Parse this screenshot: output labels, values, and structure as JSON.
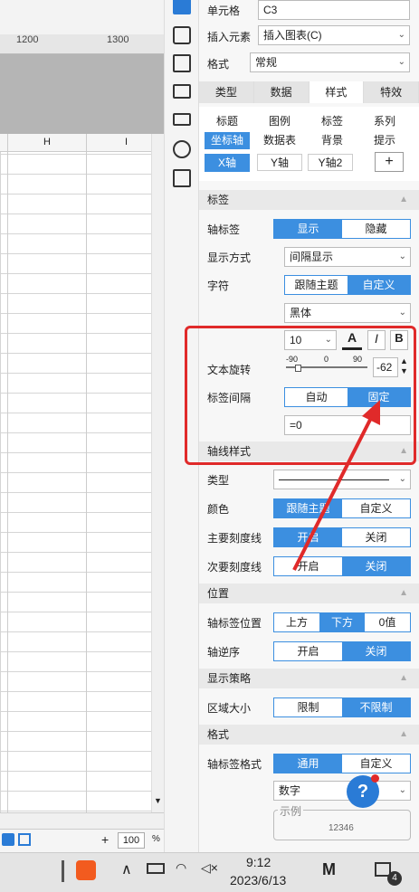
{
  "sheet": {
    "ruler_ticks": [
      "1200",
      "1300"
    ],
    "col_headers": [
      "H",
      "I"
    ],
    "zoom": "100",
    "zoom_unit": "%",
    "plus": "+"
  },
  "panel": {
    "cell_label": "单元格",
    "cell_value": "C3",
    "insert_label": "插入元素",
    "insert_value": "插入图表(C)",
    "format_label": "格式",
    "format_value": "常规",
    "tabs": [
      "类型",
      "数据",
      "样式",
      "特效"
    ],
    "subtabs_row1": [
      "标题",
      "图例",
      "标签",
      "系列"
    ],
    "subtabs_row2": [
      "坐标轴",
      "数据表",
      "背景",
      "提示"
    ],
    "axis_tabs": [
      "X轴",
      "Y轴",
      "Y轴2"
    ],
    "add": "+",
    "sec_label": "标签",
    "axis_label": "轴标签",
    "show": "显示",
    "hide": "隐藏",
    "display_mode": "显示方式",
    "display_mode_value": "间隔显示",
    "font_label": "字符",
    "follow_theme": "跟随主题",
    "custom": "自定义",
    "font_value": "黑体",
    "font_size": "10",
    "bold": "B",
    "italic": "I",
    "color_a": "A",
    "rotate_label": "文本旋转",
    "rotate_ticks": [
      "-90",
      "0",
      "90"
    ],
    "rotate_value": "-62",
    "interval_label": "标签间隔",
    "auto": "自动",
    "fixed": "固定",
    "interval_value": "=0",
    "sec_line": "轴线样式",
    "type_label": "类型",
    "color_label": "颜色",
    "major_tick": "主要刻度线",
    "minor_tick": "次要刻度线",
    "on": "开启",
    "off": "关闭",
    "sec_pos": "位置",
    "label_pos": "轴标签位置",
    "top": "上方",
    "bottom": "下方",
    "zero": "0值",
    "reverse": "轴逆序",
    "sec_strategy": "显示策略",
    "area_size": "区域大小",
    "limit": "限制",
    "no_limit": "不限制",
    "sec_format": "格式",
    "label_format": "轴标签格式",
    "general": "通用",
    "number": "数字",
    "example": "示例",
    "example_value": "12346",
    "help": "?"
  },
  "taskbar": {
    "time": "9:12",
    "date": "2023/6/13",
    "notif": "4"
  }
}
